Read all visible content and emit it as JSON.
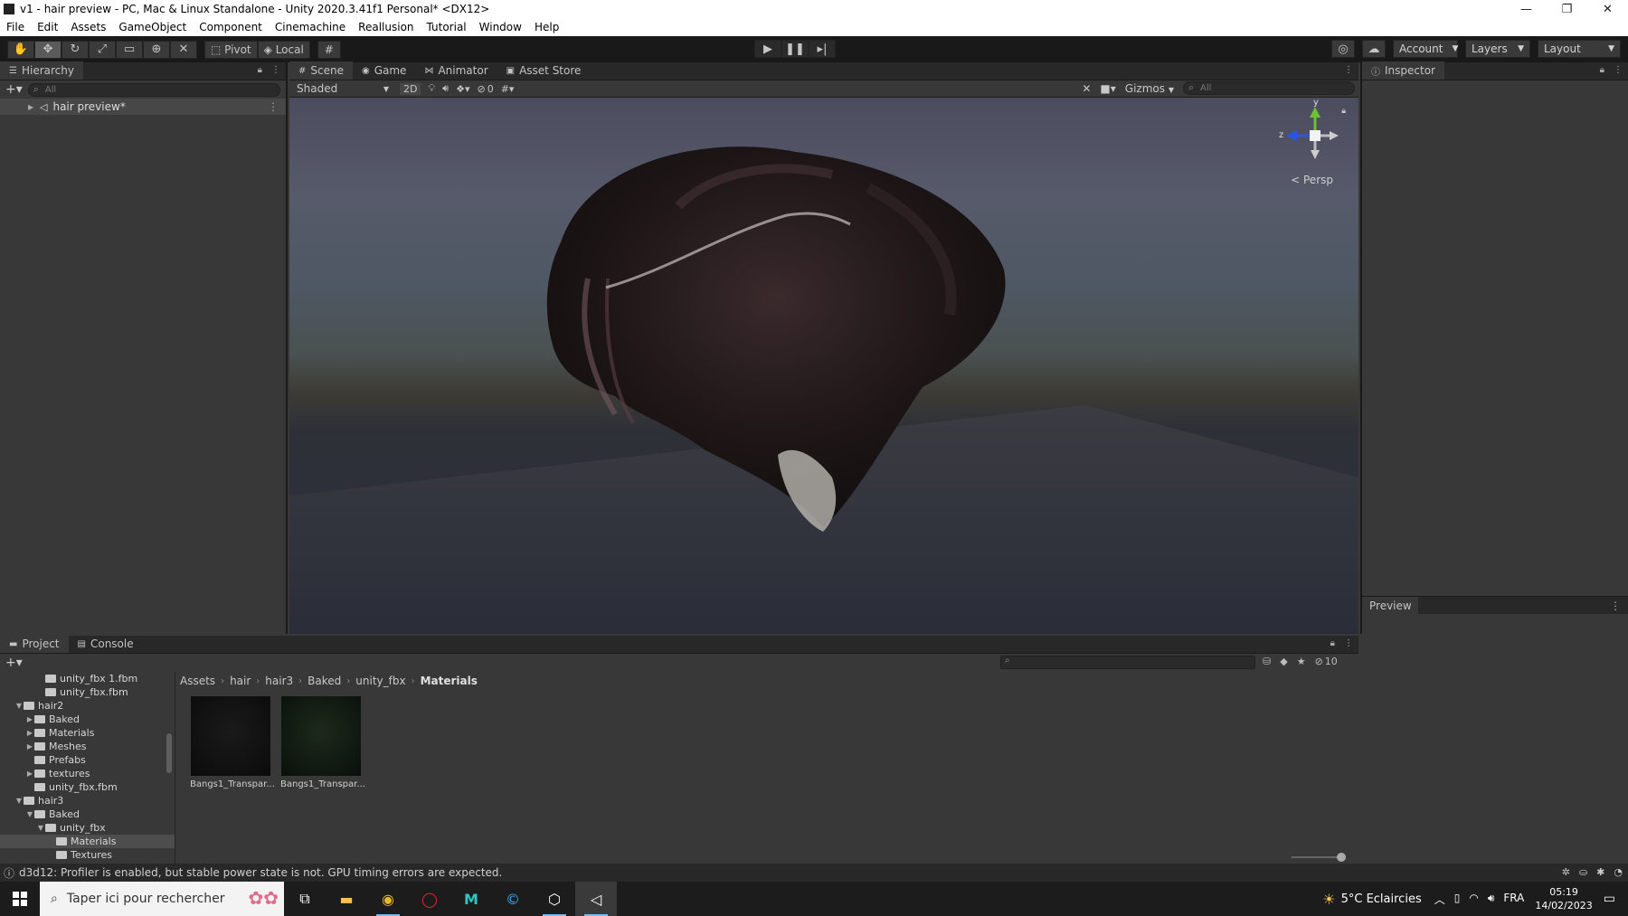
{
  "window": {
    "title": "v1 - hair preview - PC, Mac & Linux Standalone - Unity 2020.3.41f1 Personal* <DX12>",
    "minimize": "—",
    "restore": "❐",
    "close": "✕"
  },
  "menu": [
    "File",
    "Edit",
    "Assets",
    "GameObject",
    "Component",
    "Cinemachine",
    "Reallusion",
    "Tutorial",
    "Window",
    "Help"
  ],
  "toolbar": {
    "tools": [
      "hand-icon",
      "move-icon",
      "rotate-icon",
      "scale-icon",
      "rect-icon",
      "transform-icon",
      "custom-tool-icon"
    ],
    "pivot": "Pivot",
    "local": "Local",
    "account": "Account",
    "layers": "Layers",
    "layout": "Layout"
  },
  "hierarchy": {
    "tab": "Hierarchy",
    "search_placeholder": "All",
    "root": "hair preview*"
  },
  "scene": {
    "tabs": [
      "Scene",
      "Game",
      "Animator",
      "Asset Store"
    ],
    "shading": "Shaded",
    "mode2d": "2D",
    "hidden_count": "0",
    "gizmos": "Gizmos",
    "search_placeholder": "All",
    "projection": "Persp",
    "axis_y": "y",
    "axis_z": "z"
  },
  "inspector": {
    "tab": "Inspector",
    "preview": "Preview"
  },
  "project": {
    "tabs": [
      "Project",
      "Console"
    ],
    "hidden_count": "10",
    "tree": [
      {
        "label": "unity_fbx 1.fbm",
        "indent": 3,
        "arrow": ""
      },
      {
        "label": "unity_fbx.fbm",
        "indent": 3,
        "arrow": ""
      },
      {
        "label": "hair2",
        "indent": 1,
        "arrow": "▼"
      },
      {
        "label": "Baked",
        "indent": 2,
        "arrow": "▶"
      },
      {
        "label": "Materials",
        "indent": 2,
        "arrow": "▶"
      },
      {
        "label": "Meshes",
        "indent": 2,
        "arrow": "▶"
      },
      {
        "label": "Prefabs",
        "indent": 2,
        "arrow": ""
      },
      {
        "label": "textures",
        "indent": 2,
        "arrow": "▶"
      },
      {
        "label": "unity_fbx.fbm",
        "indent": 2,
        "arrow": ""
      },
      {
        "label": "hair3",
        "indent": 1,
        "arrow": "▼"
      },
      {
        "label": "Baked",
        "indent": 2,
        "arrow": "▼"
      },
      {
        "label": "unity_fbx",
        "indent": 3,
        "arrow": "▼"
      },
      {
        "label": "Materials",
        "indent": 4,
        "arrow": "",
        "selected": true
      },
      {
        "label": "Textures",
        "indent": 4,
        "arrow": ""
      }
    ],
    "breadcrumb": [
      "Assets",
      "hair",
      "hair3",
      "Baked",
      "unity_fbx",
      "Materials"
    ],
    "assets": [
      {
        "label": "Bangs1_Transpar...",
        "tint": "#0f0f0f"
      },
      {
        "label": "Bangs1_Transpar...",
        "tint": "#0f1a0f"
      }
    ]
  },
  "status": {
    "message": "d3d12: Profiler is enabled, but stable power state is not. GPU timing errors are expected."
  },
  "taskbar": {
    "search_placeholder": "Taper ici pour rechercher",
    "weather": "5°C  Eclaircies",
    "lang": "FRA",
    "time": "05:19",
    "date": "14/02/2023"
  }
}
